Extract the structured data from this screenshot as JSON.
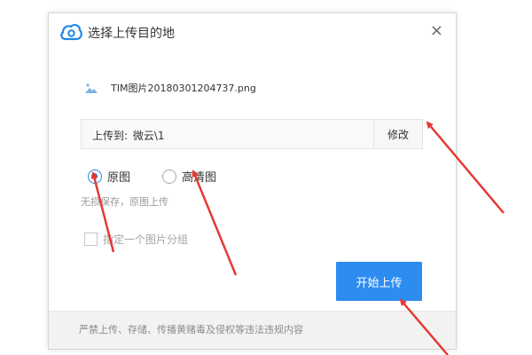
{
  "dialog": {
    "title": "选择上传目的地",
    "close_label": "×"
  },
  "file": {
    "name": "TIM图片20180301204737.png",
    "icon": "image-icon"
  },
  "destination": {
    "label": "上传到:",
    "path": "微云\\1",
    "modify_label": "修改"
  },
  "quality": {
    "options": [
      {
        "label": "原图",
        "checked": true
      },
      {
        "label": "高清图",
        "checked": false
      }
    ],
    "hint": "无损保存，原图上传"
  },
  "group": {
    "label": "指定一个图片分组",
    "checked": false
  },
  "start_button": {
    "label": "开始上传"
  },
  "footer": {
    "text": "严禁上传、存储、传播黄赌毒及侵权等违法违规内容"
  },
  "colors": {
    "accent": "#2d8cf0",
    "annotation_arrow": "#e53935"
  }
}
